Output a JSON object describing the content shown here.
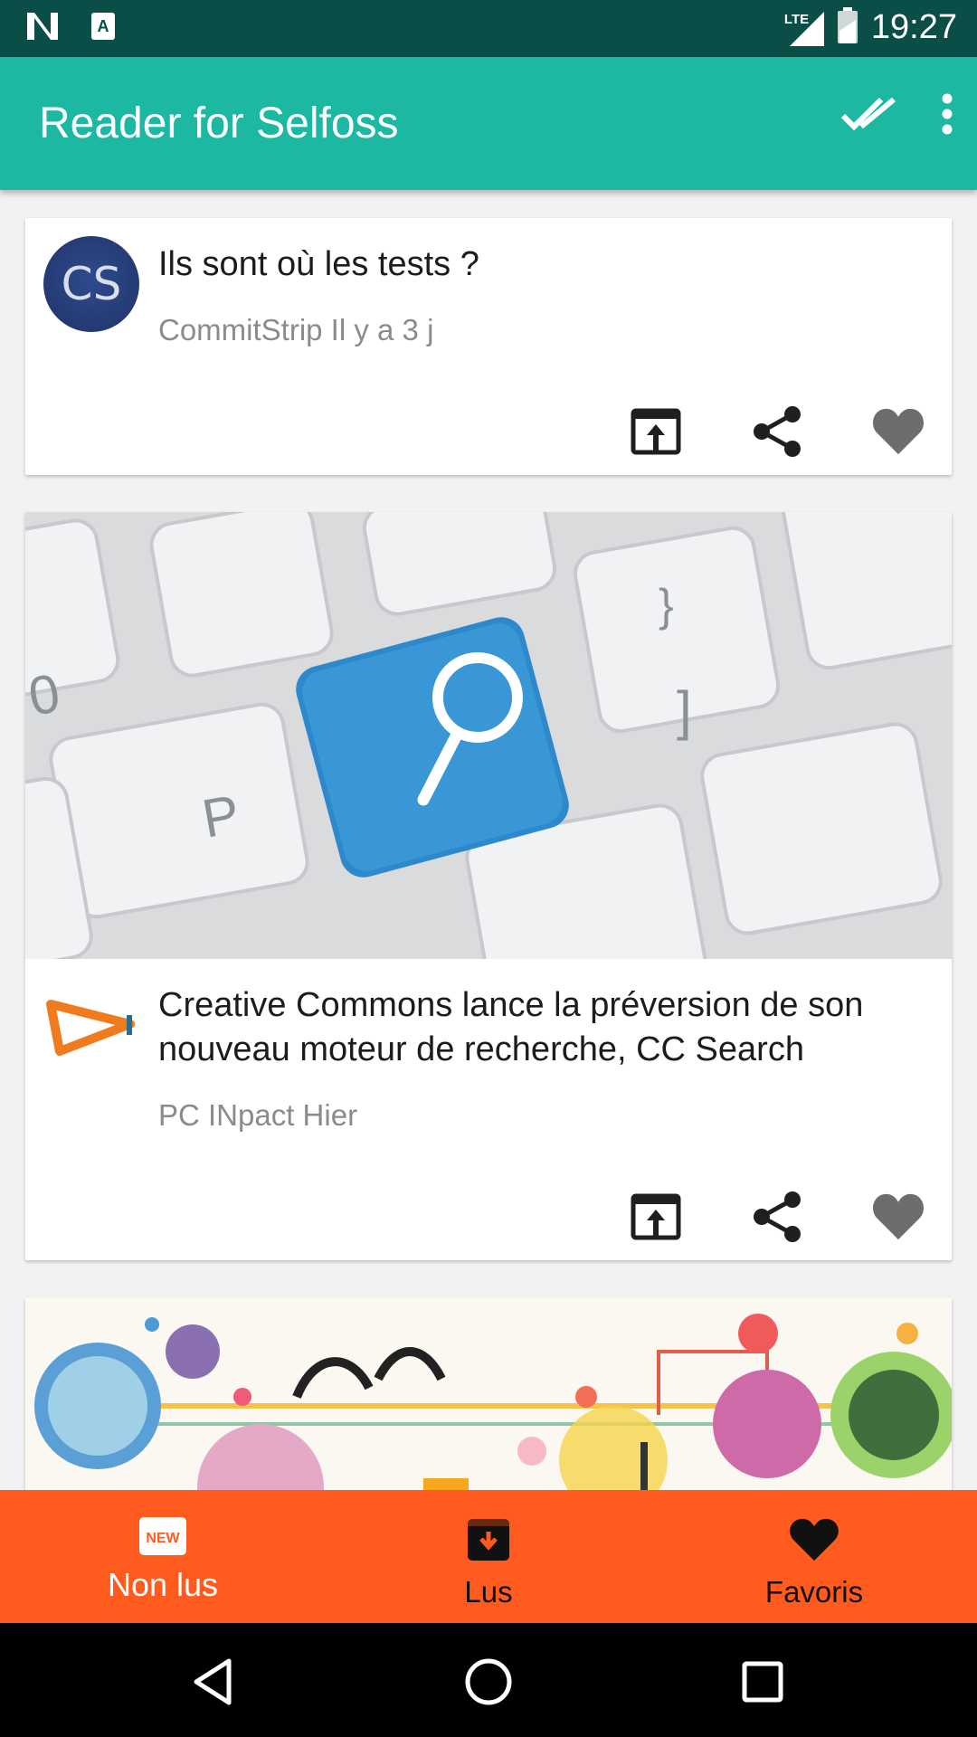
{
  "status_bar": {
    "time": "19:27",
    "network": "LTE",
    "icons": [
      "notification-n-icon",
      "keyboard-a-icon",
      "signal-icon",
      "battery-icon"
    ]
  },
  "app_bar": {
    "title": "Reader for Selfoss",
    "actions": [
      {
        "name": "mark-all-read-icon"
      },
      {
        "name": "more-options-icon"
      }
    ]
  },
  "articles": [
    {
      "title": "Ils sont où les tests ?",
      "meta": "CommitStrip Il y a 3 j",
      "thumb_text": "CS",
      "has_image": false
    },
    {
      "title": "Creative Commons lance la préversion de son nouveau moteur de recherche, CC Search",
      "meta": "PC INpact Hier",
      "has_image": true
    },
    {
      "title": "",
      "meta": "",
      "has_image": true
    }
  ],
  "article_actions": {
    "open": "open-in-browser-icon",
    "share": "share-icon",
    "favorite": "heart-icon"
  },
  "bottom_nav": {
    "items": [
      {
        "label": "Non lus",
        "icon_text": "NEW",
        "active": true
      },
      {
        "label": "Lus",
        "active": false
      },
      {
        "label": "Favoris",
        "active": false
      }
    ]
  },
  "colors": {
    "status_bar": "#0b4e48",
    "app_bar": "#1cb8a2",
    "bottom_nav": "#ff5b1f",
    "action_icon": "#6d6d6d"
  }
}
